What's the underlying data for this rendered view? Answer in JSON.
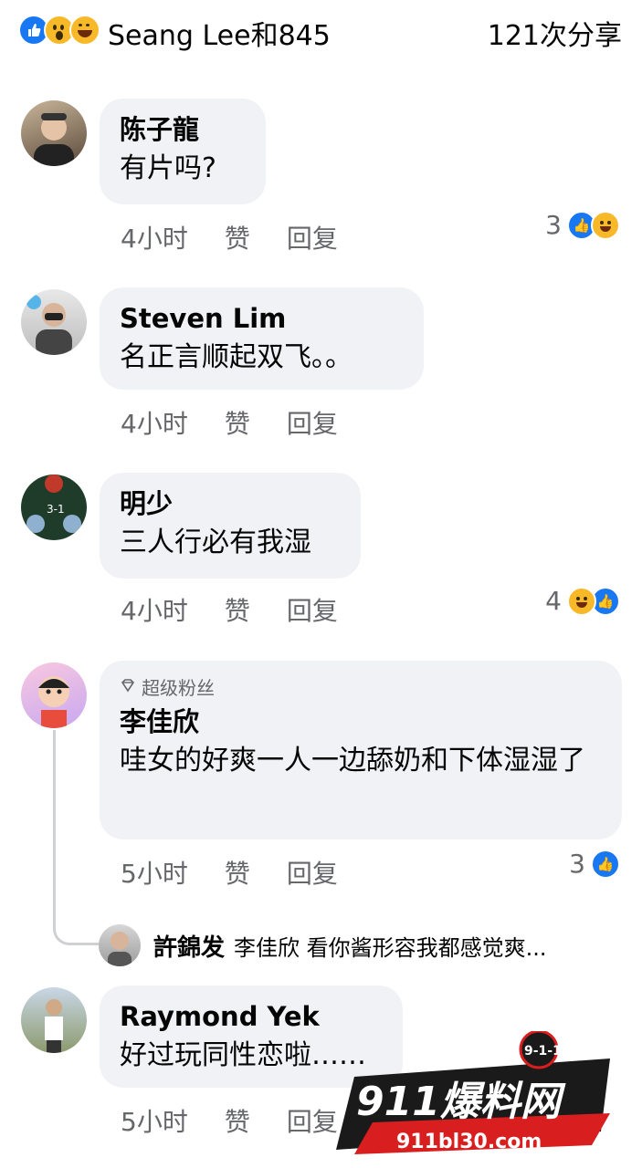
{
  "header": {
    "reactor_summary": "Seang Lee和845",
    "shares": "121次分享",
    "reactions": [
      "like-icon",
      "wow-icon",
      "haha-icon"
    ]
  },
  "comments": [
    {
      "name": "陈子龍",
      "text": "有片吗?",
      "time": "4小时",
      "like": "赞",
      "reply": "回复",
      "reaction_count": "3",
      "reactions": [
        "like-icon",
        "haha-icon"
      ]
    },
    {
      "name": "Steven Lim",
      "text": "名正言顺起双飞。。",
      "time": "4小时",
      "like": "赞",
      "reply": "回复"
    },
    {
      "name": "明少",
      "text": "三人行必有我湿",
      "time": "4小时",
      "like": "赞",
      "reply": "回复",
      "reaction_count": "4",
      "reactions": [
        "haha-icon",
        "like-icon"
      ]
    },
    {
      "badge": "超级粉丝",
      "name": "李佳欣",
      "text": "哇女的好爽一人一边舔奶和下体湿湿了",
      "time": "5小时",
      "like": "赞",
      "reply": "回复",
      "reaction_count": "3",
      "reactions": [
        "like-icon"
      ]
    },
    {
      "name": "Raymond Yek",
      "text": "好过玩同性恋啦……",
      "time": "5小时",
      "like": "赞",
      "reply": "回复"
    }
  ],
  "reply_preview": {
    "name": "許錦发",
    "text": "李佳欣 看你酱形容我都感觉爽..."
  },
  "watermark": {
    "brand": "911爆料网",
    "tag": "9-1-1",
    "url": "911bl30.com"
  },
  "colors": {
    "like": "#1877f2",
    "haha": "#f7b928",
    "bubble": "#f0f2f5",
    "meta": "#65676b"
  }
}
